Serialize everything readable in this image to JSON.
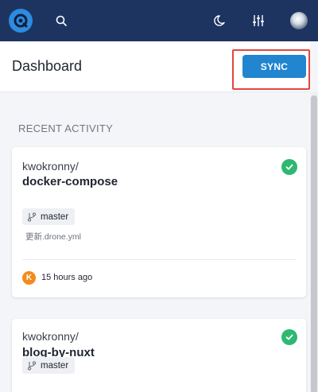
{
  "topbar": {
    "logo_icon": "drone-logo-icon",
    "search_icon": "search-icon",
    "theme_icon": "moon-icon",
    "settings_icon": "sliders-icon",
    "avatar_icon": "user-avatar",
    "bg_color": "#1d3461"
  },
  "header": {
    "title": "Dashboard",
    "sync_label": "SYNC",
    "accent_color": "#2185d0",
    "highlight_color": "#e2463f"
  },
  "recent_activity": {
    "title": "RECENT ACTIVITY",
    "cards": [
      {
        "owner": "kwokronny/",
        "repo": "docker-compose",
        "status": "success",
        "branch": "master",
        "commit_message": "更新.drone.yml",
        "author_initial": "K",
        "time": "15 hours ago"
      },
      {
        "owner": "kwokronny/",
        "repo": "blog-by-nuxt",
        "status": "success",
        "branch": "master"
      }
    ]
  }
}
